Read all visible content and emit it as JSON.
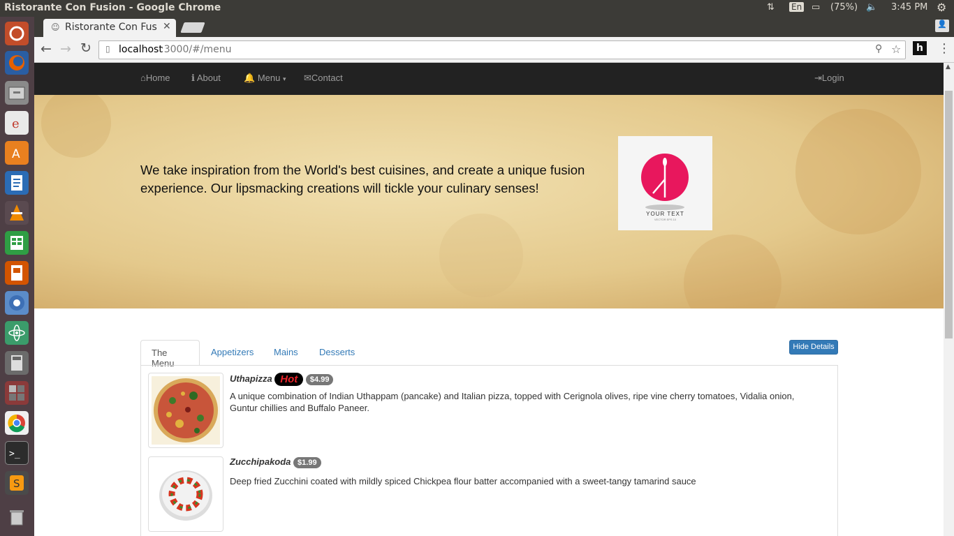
{
  "window": {
    "title": "Ristorante Con Fusion - Google Chrome",
    "indicators": {
      "keyboard": "En",
      "battery": "(75%)",
      "clock": "3:45 PM"
    }
  },
  "launcher": {
    "apps": [
      "ubuntu-dash-icon",
      "firefox-icon",
      "files-icon",
      "mail-icon",
      "software-center-icon",
      "writer-icon",
      "vlc-icon",
      "calc-icon",
      "impress-icon",
      "chromium-icon",
      "atom-icon",
      "calculator-icon",
      "workspaces-icon",
      "chrome-icon",
      "terminal-icon",
      "sublime-icon",
      "trash-icon"
    ]
  },
  "browser": {
    "tab_title": "Ristorante Con Fus",
    "url_host": "localhost",
    "url_rest": ":3000/#/menu"
  },
  "navbar": {
    "home": "Home",
    "about": "About",
    "menu": "Menu",
    "contact": "Contact",
    "login": "Login"
  },
  "jumbotron": {
    "text": "We take inspiration from the World's best cuisines, and create a unique fusion experience. Our lipsmacking creations will tickle your culinary senses!",
    "logo_caption": "YOUR TEXT",
    "logo_subcaption": "VECTOR EPS 10"
  },
  "menu_tabs": [
    "The Menu",
    "Appetizers",
    "Mains",
    "Desserts"
  ],
  "hide_button": "Hide Details",
  "dishes": [
    {
      "name": "Uthapizza",
      "label": "Hot",
      "price": "$4.99",
      "description": "A unique combination of Indian Uthappam (pancake) and Italian pizza, topped with Cerignola olives, ripe vine cherry tomatoes, Vidalia onion, Guntur chillies and Buffalo Paneer."
    },
    {
      "name": "Zucchipakoda",
      "label": "",
      "price": "$1.99",
      "description": "Deep fried Zucchini coated with mildly spiced Chickpea flour batter accompanied with a sweet-tangy tamarind sauce"
    }
  ],
  "colors": {
    "navbar_bg": "#222222",
    "link": "#337ab7",
    "primary_button": "#337ab7",
    "badge": "#777777",
    "hot_label_text": "#e8232a"
  }
}
